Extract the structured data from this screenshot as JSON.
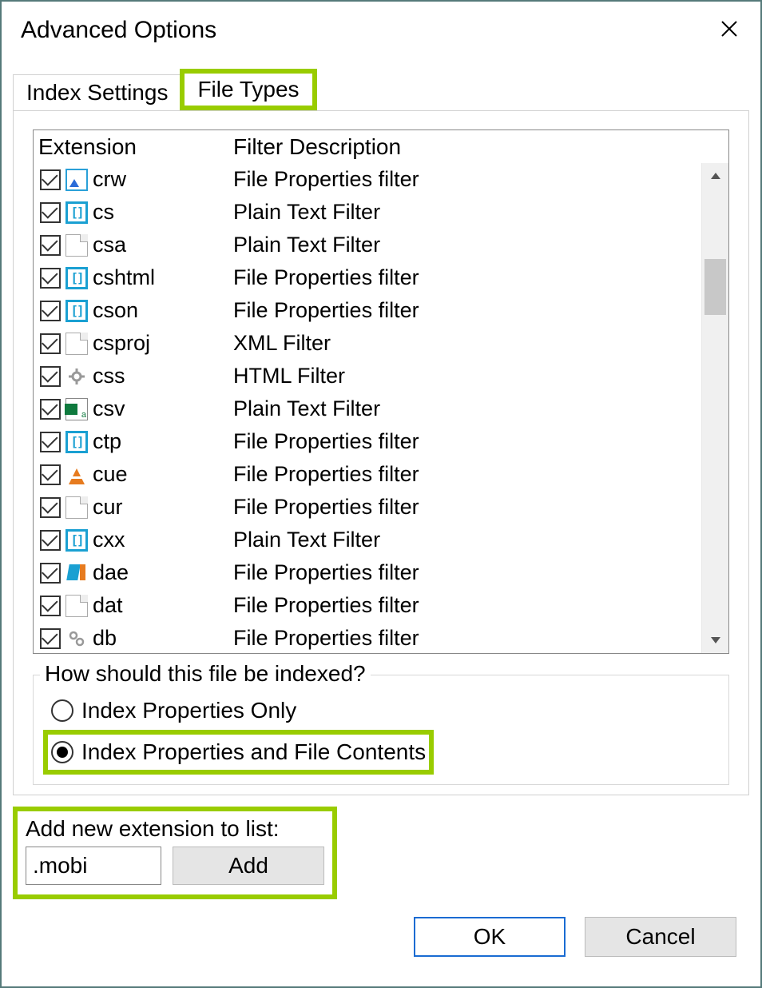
{
  "window": {
    "title": "Advanced Options"
  },
  "tabs": {
    "inactive": "Index Settings",
    "active": "File Types"
  },
  "columns": {
    "ext": "Extension",
    "desc": "Filter Description"
  },
  "rows": [
    {
      "ext": "crw",
      "desc": "File Properties filter",
      "icon": "img"
    },
    {
      "ext": "cs",
      "desc": "Plain Text Filter",
      "icon": "br"
    },
    {
      "ext": "csa",
      "desc": "Plain Text Filter",
      "icon": "blank"
    },
    {
      "ext": "cshtml",
      "desc": "File Properties filter",
      "icon": "br"
    },
    {
      "ext": "cson",
      "desc": "File Properties filter",
      "icon": "br"
    },
    {
      "ext": "csproj",
      "desc": "XML Filter",
      "icon": "blank"
    },
    {
      "ext": "css",
      "desc": "HTML Filter",
      "icon": "gear"
    },
    {
      "ext": "csv",
      "desc": "Plain Text Filter",
      "icon": "xl"
    },
    {
      "ext": "ctp",
      "desc": "File Properties filter",
      "icon": "br"
    },
    {
      "ext": "cue",
      "desc": "File Properties filter",
      "icon": "cone"
    },
    {
      "ext": "cur",
      "desc": "File Properties filter",
      "icon": "blank"
    },
    {
      "ext": "cxx",
      "desc": "Plain Text Filter",
      "icon": "br"
    },
    {
      "ext": "dae",
      "desc": "File Properties filter",
      "icon": "dae"
    },
    {
      "ext": "dat",
      "desc": "File Properties filter",
      "icon": "blank"
    },
    {
      "ext": "db",
      "desc": "File Properties filter",
      "icon": "db"
    }
  ],
  "indexing": {
    "legend": "How should this file be indexed?",
    "opt1": "Index Properties Only",
    "opt2": "Index Properties and File Contents"
  },
  "add": {
    "label": "Add new extension to list:",
    "value": ".mobi",
    "button": "Add"
  },
  "buttons": {
    "ok": "OK",
    "cancel": "Cancel"
  }
}
